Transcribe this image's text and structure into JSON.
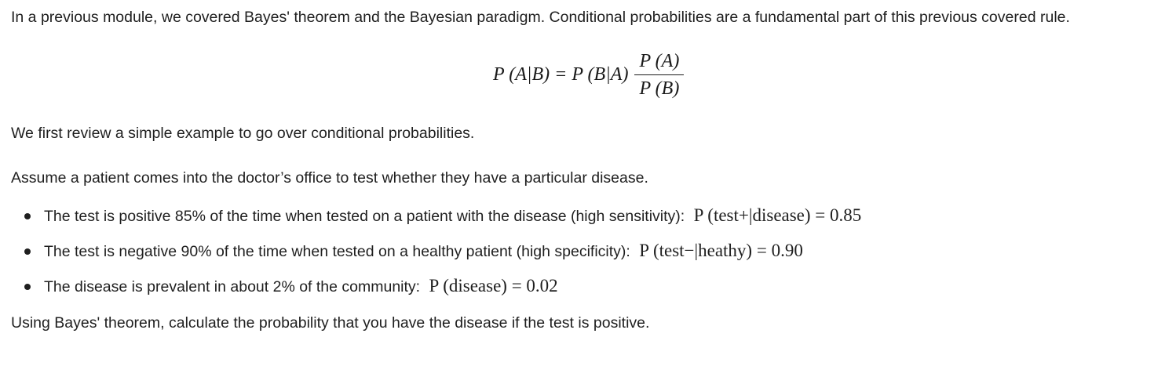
{
  "intro": {
    "text": "In a previous module, we covered Bayes' theorem and the Bayesian paradigm. Conditional probabilities are a fundamental part of this previous covered rule."
  },
  "equation": {
    "lhs": "P (A|B) = P (B|A)",
    "numerator": "P (A)",
    "denominator": "P (B)"
  },
  "review": {
    "text": "We first review a simple example to go over conditional probabilities."
  },
  "scenario": {
    "text": "Assume a patient comes into the doctor’s office to test whether they have a particular disease."
  },
  "bullets": [
    {
      "text": "The test is positive 85% of the time when tested on a patient with the disease (high sensitivity):",
      "math": "P (test+|disease) = 0.85"
    },
    {
      "text": "The test is negative 90% of the time when tested on a healthy patient (high specificity):",
      "math": "P (test−|heathy) = 0.90"
    },
    {
      "text": "The disease is prevalent in about 2% of the community:",
      "math": "P (disease) = 0.02"
    }
  ],
  "question": {
    "text": "Using Bayes' theorem, calculate the probability that you have the disease if the test is positive."
  }
}
